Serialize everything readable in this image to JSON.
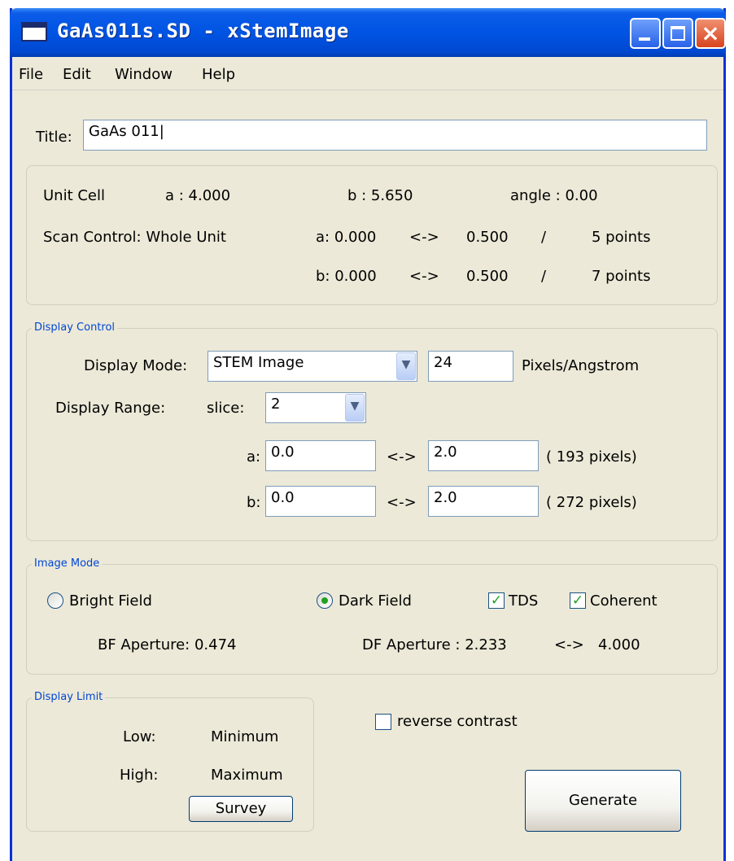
{
  "window": {
    "title": "GaAs011s.SD - xStemImage",
    "title_color": "#0054e3",
    "background": "#ece9d8"
  },
  "menu": [
    {
      "label": "File"
    },
    {
      "label": "Edit"
    },
    {
      "label": "Window"
    },
    {
      "label": "Help"
    }
  ],
  "title_field": {
    "label": "Title:",
    "value": "GaAs 011|"
  },
  "unit_cell": {
    "label": "Unit Cell",
    "a": "a : 4.000",
    "b": "b : 5.650",
    "angle": "angle : 0.00"
  },
  "scan_control": {
    "label": "Scan Control: Whole Unit",
    "a_from": "a: 0.000",
    "a_arrow": "<->",
    "a_to": "0.500",
    "a_sep": "/",
    "a_points": "5 points",
    "b_from": "b: 0.000",
    "b_arrow": "<->",
    "b_to": "0.500",
    "b_sep": "/",
    "b_points": "7 points"
  },
  "display_control": {
    "legend": "Display Control",
    "mode_label": "Display Mode:",
    "mode_value": "STEM Image",
    "pixels_value": "24",
    "pixels_unit": "Pixels/Angstrom",
    "range_label": "Display Range:",
    "slice_label": "slice:",
    "slice_value": "2",
    "a_label": "a:",
    "a_from": "0.0",
    "a_arrow": "<->",
    "a_to": "2.0",
    "a_pixels": "( 193 pixels)",
    "b_label": "b:",
    "b_from": "0.0",
    "b_arrow": "<->",
    "b_to": "2.0",
    "b_pixels": "( 272 pixels)"
  },
  "image_mode": {
    "legend": "Image Mode",
    "bright_field": "Bright Field",
    "bright_selected": false,
    "dark_field": "Dark Field",
    "dark_selected": true,
    "tds": "TDS",
    "tds_checked": true,
    "coherent": "Coherent",
    "coherent_checked": true,
    "bf_aperture": "BF Aperture: 0.474",
    "df_aperture": "DF Aperture : 2.233",
    "df_arrow": "<->",
    "df_max": "4.000"
  },
  "display_limit": {
    "legend": "Display Limit",
    "low_label": "Low:",
    "low_value": "Minimum",
    "high_label": "High:",
    "high_value": "Maximum",
    "survey_button": "Survey"
  },
  "reverse_contrast": {
    "label": "reverse contrast",
    "checked": false
  },
  "generate_button": "Generate",
  "icons": {
    "app": "window-app-icon",
    "minimize": "minimize-icon",
    "maximize": "maximize-icon",
    "close": "close-icon",
    "dropdown": "chevron-down-icon",
    "check": "checkmark-icon"
  }
}
